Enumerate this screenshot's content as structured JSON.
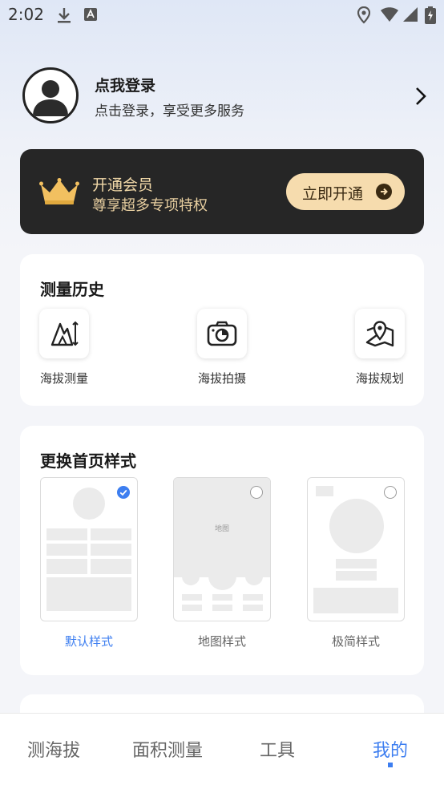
{
  "status_bar": {
    "time": "2:02"
  },
  "profile": {
    "title": "点我登录",
    "subtitle": "点击登录，享受更多服务"
  },
  "vip": {
    "title": "开通会员",
    "subtitle": "尊享超多专项特权",
    "button_label": "立即开通"
  },
  "history": {
    "title": "测量历史",
    "items": [
      {
        "label": "海拔测量",
        "icon": "altitude-measure-icon"
      },
      {
        "label": "海拔拍摄",
        "icon": "camera-icon"
      },
      {
        "label": "海拔规划",
        "icon": "map-pin-icon"
      }
    ]
  },
  "home_style": {
    "title": "更换首页样式",
    "options": [
      {
        "label": "默认样式",
        "selected": true
      },
      {
        "label": "地图样式",
        "selected": false,
        "map_text": "地图"
      },
      {
        "label": "极简样式",
        "selected": false
      }
    ]
  },
  "tabbar": {
    "tabs": [
      {
        "label": "测海拔",
        "active": false
      },
      {
        "label": "面积测量",
        "active": false
      },
      {
        "label": "工具",
        "active": false
      },
      {
        "label": "我的",
        "active": true
      }
    ]
  },
  "colors": {
    "accent": "#3d7ef0",
    "vip_bg": "#262626",
    "vip_gold": "#f6dcae"
  }
}
